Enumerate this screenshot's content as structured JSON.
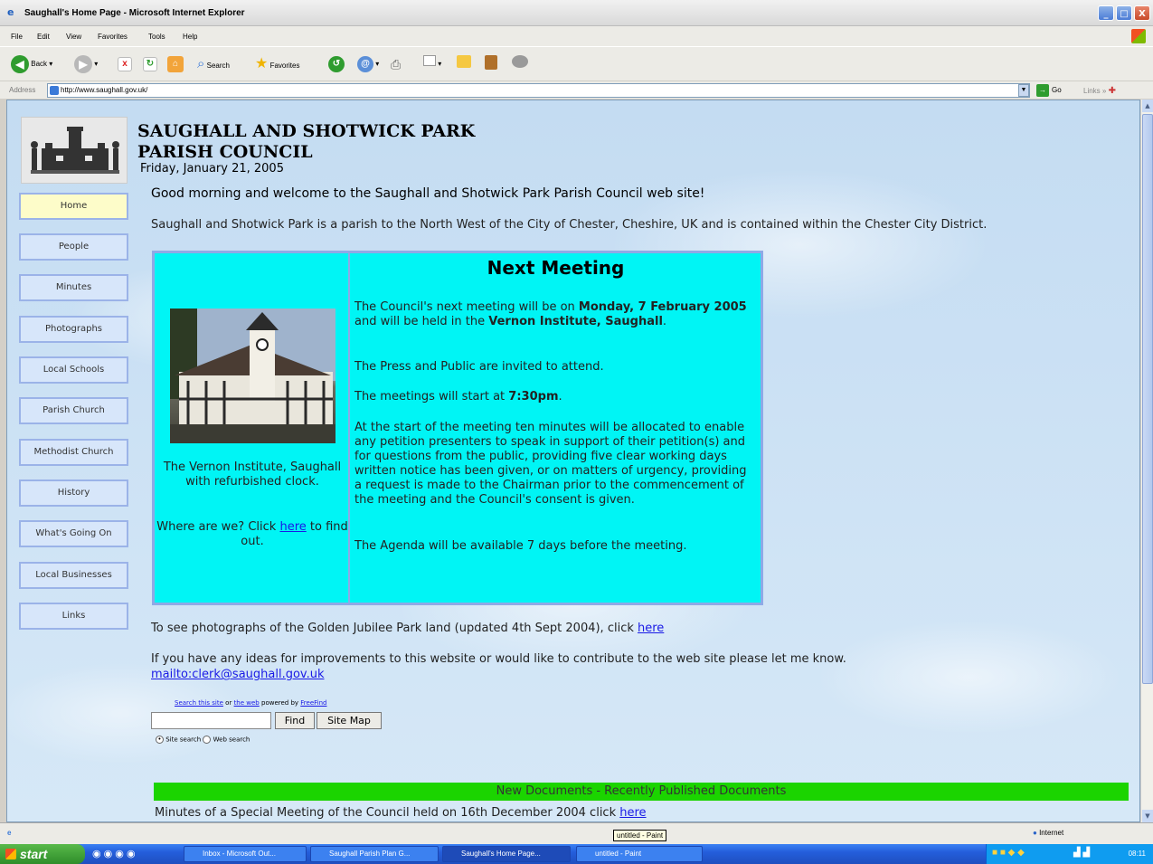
{
  "window": {
    "title": "Saughall's Home Page - Microsoft Internet Explorer",
    "min": "_",
    "max": "□",
    "close": "X"
  },
  "menu": [
    "File",
    "Edit",
    "View",
    "Favorites",
    "Tools",
    "Help"
  ],
  "toolbar": {
    "back": "Back",
    "search": "Search",
    "favorites": "Favorites"
  },
  "address": {
    "label": "Address",
    "url": "http://www.saughall.gov.uk/",
    "go": "Go",
    "links": "Links"
  },
  "site": {
    "name": "SAUGHALL AND SHOTWICK PARK PARISH COUNCIL",
    "date": "Friday, January 21, 2005",
    "welcome": "Good morning and welcome to the Saughall and Shotwick Park Parish Council web site!",
    "intro": "Saughall and Shotwick Park is a parish to the North West of the City of Chester, Cheshire, UK and is contained within the Chester City District."
  },
  "nav": [
    "Home",
    "People",
    "Minutes",
    "Photographs",
    "Local Schools",
    "Parish Church",
    "Methodist Church",
    "History",
    "What's Going On",
    "Local Businesses",
    "Links"
  ],
  "meeting": {
    "title": "Next Meeting",
    "p1_pre": "The Council's next meeting will be on ",
    "p1_date": "Monday, 7 February 2005",
    "p1_mid": " and will be held in the ",
    "p1_place": "Vernon Institute, Saughall",
    "p1_end": ".",
    "p2": "The Press and Public are invited to attend.",
    "p3_pre": "The meetings will start at ",
    "p3_time": "7:30pm",
    "p3_end": ".",
    "p4": "At the start of the meeting ten minutes will be allocated to enable any petition presenters to speak in support of their petition(s) and for questions from the public, providing five clear working days written notice has been given, or on matters of urgency, providing a request is made to the Chairman prior to the commencement of the meeting and the Council's consent is given.",
    "p5": "The Agenda will be available 7 days before the meeting.",
    "caption": "The Vernon Institute, Saughall with refurbished clock.",
    "where_pre": "Where are we? Click ",
    "where_link": "here",
    "where_post": " to find out."
  },
  "photos_line": {
    "text": "To see photographs of the Golden Jubilee Park land (updated 4th Sept 2004), click ",
    "link": "here"
  },
  "ideas": {
    "text": "If you have any ideas for improvements to this website or would like to contribute to the web site please let me know.",
    "mailto": "mailto:clerk@saughall.gov.uk"
  },
  "search": {
    "search_site": "Search this site",
    "or": "or",
    "the_web": "the web",
    "powered": "powered by",
    "freefind": "FreeFind",
    "find": "Find",
    "sitemap": "Site Map",
    "site_search": "Site search",
    "web_search": "Web search"
  },
  "docs": {
    "heading": "New Documents - Recently Published Documents",
    "line": "Minutes of a Special Meeting of the Council held on 16th December 2004 click ",
    "link": "here"
  },
  "status": {
    "zone": "Internet",
    "tooltip": "untitled - Paint"
  },
  "taskbar": {
    "start": "start",
    "tasks": [
      "Inbox - Microsoft Out...",
      "Saughall Parish Plan G...",
      "Saughall's Home Page...",
      "untitled - Paint"
    ],
    "clock": "08:11"
  }
}
